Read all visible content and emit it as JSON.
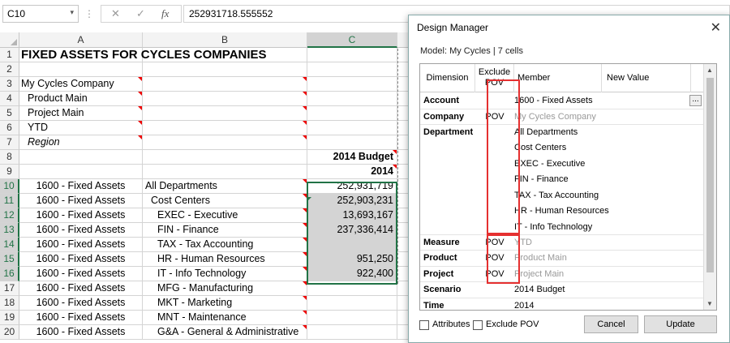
{
  "formula_bar": {
    "name_box": "C10",
    "name_box_arrow": "▾",
    "separator": "⋮",
    "cancel_icon": "✕",
    "enter_icon": "✓",
    "fx_label": "fx",
    "formula": "252931718.555552"
  },
  "columns": [
    "A",
    "B",
    "C"
  ],
  "rows": [
    {
      "n": "1",
      "a": "FIXED ASSETS FOR CYCLES COMPANIES",
      "b": "",
      "c": ""
    },
    {
      "n": "2",
      "a": "",
      "b": "",
      "c": ""
    },
    {
      "n": "3",
      "a": "My Cycles Company",
      "b": "",
      "c": ""
    },
    {
      "n": "4",
      "a": "  Product Main",
      "b": "",
      "c": ""
    },
    {
      "n": "5",
      "a": "  Project Main",
      "b": "",
      "c": ""
    },
    {
      "n": "6",
      "a": "  YTD",
      "b": "",
      "c": ""
    },
    {
      "n": "7",
      "a": "  Region",
      "b": "",
      "c": ""
    },
    {
      "n": "8",
      "a": "",
      "b": "",
      "c": "2014 Budget"
    },
    {
      "n": "9",
      "a": "",
      "b": "",
      "c": "2014"
    },
    {
      "n": "10",
      "a": "1600 - Fixed Assets",
      "b": "All Departments",
      "c": "252,931,719"
    },
    {
      "n": "11",
      "a": "1600 - Fixed Assets",
      "b": "Cost Centers",
      "c": "252,903,231"
    },
    {
      "n": "12",
      "a": "1600 - Fixed Assets",
      "b": "EXEC - Executive",
      "c": "13,693,167"
    },
    {
      "n": "13",
      "a": "1600 - Fixed Assets",
      "b": "FIN - Finance",
      "c": "237,336,414"
    },
    {
      "n": "14",
      "a": "1600 - Fixed Assets",
      "b": "TAX - Tax Accounting",
      "c": ""
    },
    {
      "n": "15",
      "a": "1600 - Fixed Assets",
      "b": "HR - Human Resources",
      "c": "951,250"
    },
    {
      "n": "16",
      "a": "1600 - Fixed Assets",
      "b": "IT - Info Technology",
      "c": "922,400"
    },
    {
      "n": "17",
      "a": "1600 - Fixed Assets",
      "b": "MFG - Manufacturing",
      "c": ""
    },
    {
      "n": "18",
      "a": "1600 - Fixed Assets",
      "b": "MKT - Marketing",
      "c": ""
    },
    {
      "n": "19",
      "a": "1600 - Fixed Assets",
      "b": "MNT - Maintenance",
      "c": ""
    },
    {
      "n": "20",
      "a": "1600 - Fixed Assets",
      "b": "G&A - General & Administrative",
      "c": ""
    }
  ],
  "dialog": {
    "title": "Design Manager",
    "close_icon": "✕",
    "model_info": "Model: My Cycles | 7 cells",
    "headers": {
      "dimension": "Dimension",
      "exclude_pov_1": "Exclude",
      "exclude_pov_2": "POV",
      "member": "Member",
      "new_value": "New Value"
    },
    "ellipsis": "...",
    "rows": [
      {
        "dimension": "Account",
        "pov": "",
        "member": "1600 - Fixed Assets"
      },
      {
        "dimension": "Company",
        "pov": "POV",
        "member": "My Cycles Company"
      },
      {
        "dimension": "Department",
        "pov": "",
        "member": "All Departments"
      },
      {
        "dimension": "Measure",
        "pov": "POV",
        "member": "YTD"
      },
      {
        "dimension": "Product",
        "pov": "POV",
        "member": "Product Main"
      },
      {
        "dimension": "Project",
        "pov": "POV",
        "member": "Project Main"
      },
      {
        "dimension": "Scenario",
        "pov": "",
        "member": "2014 Budget"
      },
      {
        "dimension": "Time",
        "pov": "",
        "member": "2014"
      }
    ],
    "department_members": [
      "Cost Centers",
      "EXEC - Executive",
      "FIN - Finance",
      "TAX - Tax Accounting",
      "HR - Human Resources",
      "IT - Info Technology"
    ],
    "scroll_up": "▲",
    "scroll_down": "▼",
    "attributes_label": "Attributes",
    "exclude_pov_label": "Exclude POV",
    "cancel_label": "Cancel",
    "update_label": "Update"
  }
}
